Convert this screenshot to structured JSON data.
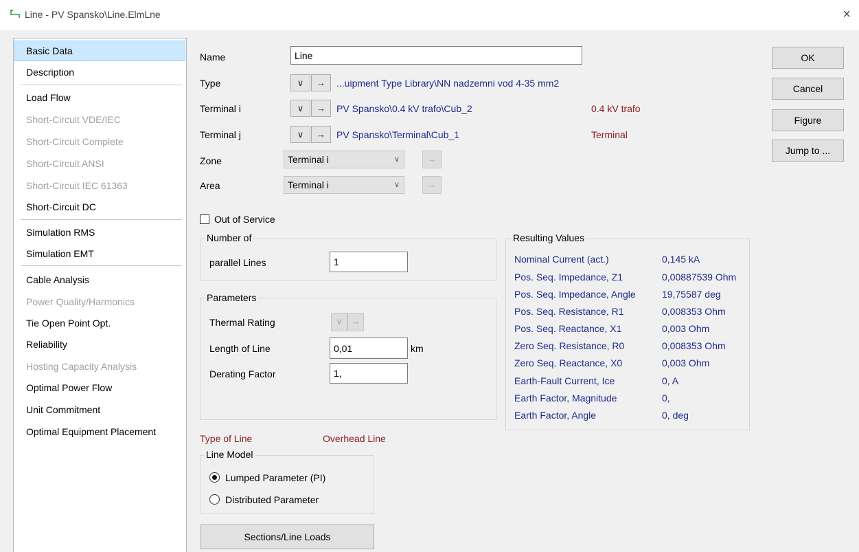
{
  "window": {
    "title": "Line - PV Spansko\\Line.ElmLne",
    "close_glyph": "×"
  },
  "nav": {
    "items": [
      {
        "label": "Basic Data",
        "state": "selected"
      },
      {
        "label": "Description",
        "state": "normal"
      },
      {
        "label": "Load Flow",
        "state": "normal"
      },
      {
        "label": "Short-Circuit VDE/IEC",
        "state": "disabled"
      },
      {
        "label": "Short-Circuit Complete",
        "state": "disabled"
      },
      {
        "label": "Short-Circuit ANSI",
        "state": "disabled"
      },
      {
        "label": "Short-Circuit IEC 61363",
        "state": "disabled"
      },
      {
        "label": "Short-Circuit DC",
        "state": "normal"
      },
      {
        "label": "Simulation RMS",
        "state": "normal"
      },
      {
        "label": "Simulation EMT",
        "state": "normal"
      },
      {
        "label": "Cable Analysis",
        "state": "normal"
      },
      {
        "label": "Power Quality/Harmonics",
        "state": "disabled"
      },
      {
        "label": "Tie Open Point Opt.",
        "state": "normal"
      },
      {
        "label": "Reliability",
        "state": "normal"
      },
      {
        "label": "Hosting Capacity Analysis",
        "state": "disabled"
      },
      {
        "label": "Optimal Power Flow",
        "state": "normal"
      },
      {
        "label": "Unit Commitment",
        "state": "normal"
      },
      {
        "label": "Optimal Equipment Placement",
        "state": "normal"
      }
    ]
  },
  "form": {
    "name_label": "Name",
    "name_value": "Line",
    "type_label": "Type",
    "type_value": "...uipment Type Library\\NN nadzemni vod 4-35 mm2",
    "terminal_i_label": "Terminal i",
    "terminal_i_value": "PV Spansko\\0.4 kV trafo\\Cub_2",
    "terminal_i_name": "0.4 kV trafo",
    "terminal_j_label": "Terminal j",
    "terminal_j_value": "PV Spansko\\Terminal\\Cub_1",
    "terminal_j_name": "Terminal",
    "zone_label": "Zone",
    "zone_value": "Terminal i",
    "area_label": "Area",
    "area_value": "Terminal i",
    "out_of_service_label": "Out of Service",
    "out_of_service_checked": false,
    "dropdown_glyph": "∨",
    "arrow_glyph": "→"
  },
  "number_of": {
    "title": "Number of",
    "parallel_lines_label": "parallel Lines",
    "parallel_lines_value": "1"
  },
  "parameters": {
    "title": "Parameters",
    "thermal_rating_label": "Thermal Rating",
    "length_label": "Length of Line",
    "length_value": "0,01",
    "length_unit": "km",
    "derating_label": "Derating Factor",
    "derating_value": "1,"
  },
  "type_of_line": {
    "label": "Type of Line",
    "value": "Overhead Line"
  },
  "line_model": {
    "title": "Line Model",
    "options": [
      {
        "label": "Lumped Parameter (PI)",
        "selected": true
      },
      {
        "label": "Distributed Parameter",
        "selected": false
      }
    ]
  },
  "sections_button": "Sections/Line Loads",
  "resulting_values": {
    "title": "Resulting Values",
    "rows": [
      {
        "label": "Nominal Current (act.)",
        "value": "0,145 kA"
      },
      {
        "label": "Pos. Seq. Impedance, Z1",
        "value": "0,00887539 Ohm"
      },
      {
        "label": "Pos. Seq. Impedance, Angle",
        "value": "19,75587 deg"
      },
      {
        "label": "Pos. Seq. Resistance, R1",
        "value": "0,008353 Ohm"
      },
      {
        "label": "Pos. Seq. Reactance, X1",
        "value": "0,003 Ohm"
      },
      {
        "label": "Zero Seq. Resistance, R0",
        "value": "0,008353 Ohm"
      },
      {
        "label": "Zero Seq. Reactance, X0",
        "value": "0,003 Ohm"
      },
      {
        "label": "Earth-Fault Current, Ice",
        "value": "0, A"
      },
      {
        "label": "Earth Factor, Magnitude",
        "value": "0,"
      },
      {
        "label": "Earth Factor, Angle",
        "value": "0, deg"
      }
    ]
  },
  "actions": {
    "ok": "OK",
    "cancel": "Cancel",
    "figure": "Figure",
    "jump_to": "Jump to ..."
  },
  "colors": {
    "value_blue": "#1e2a8c",
    "name_red": "#8b1a1a",
    "selection": "#cce8ff"
  },
  "icons": {
    "title": "line-element-icon"
  }
}
